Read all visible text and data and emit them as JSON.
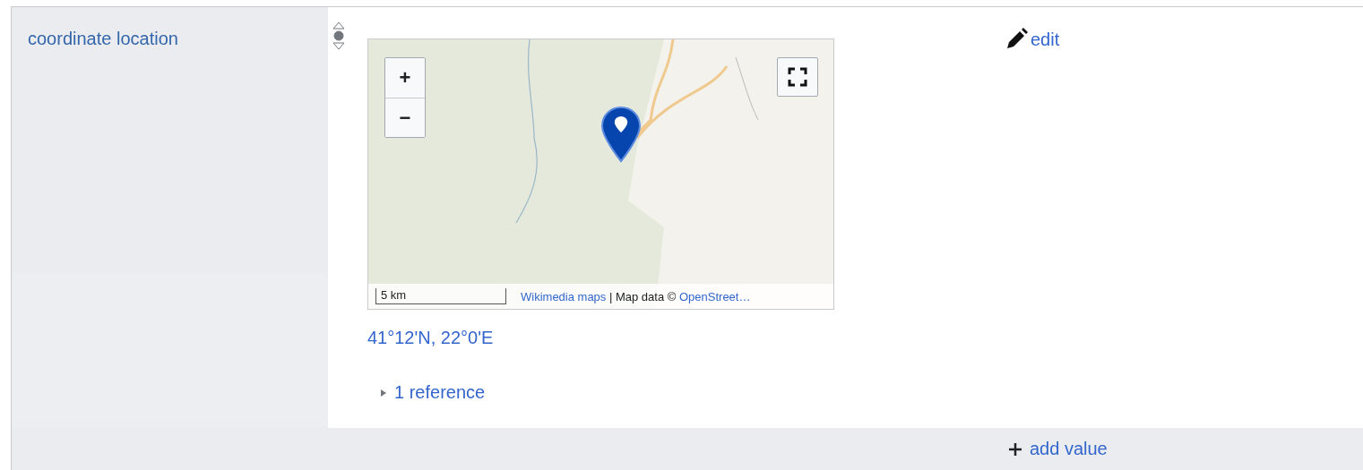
{
  "property": {
    "label": "coordinate location"
  },
  "statement": {
    "rank_options": [
      {
        "kind": "preferred",
        "selected": false
      },
      {
        "kind": "normal",
        "selected": true
      },
      {
        "kind": "deprecated",
        "selected": false
      }
    ],
    "map": {
      "zoom_in": "+",
      "zoom_out": "−",
      "scale": "5 km",
      "attribution": [
        {
          "text": "Wikimedia maps",
          "link": true
        },
        {
          "text": " | Map data © ",
          "link": false
        },
        {
          "text": "OpenStreet…",
          "link": true
        }
      ]
    },
    "value": "41°12'N, 22°0'E",
    "references": {
      "label": "1 reference",
      "expanded": false
    },
    "edit": "edit"
  },
  "add_value": "add value"
}
